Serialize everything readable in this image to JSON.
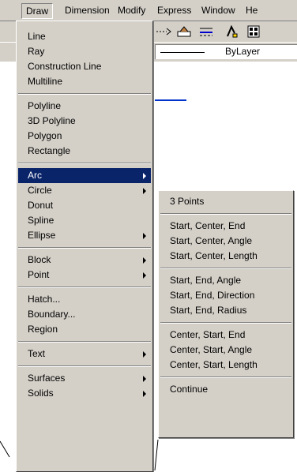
{
  "menubar": {
    "items": [
      "Draw",
      "Dimension",
      "Modify",
      "Express",
      "Window",
      "He"
    ]
  },
  "layer_combo": {
    "value": "ByLayer"
  },
  "draw_menu": {
    "groups": [
      [
        "Line",
        "Ray",
        "Construction Line",
        "Multiline"
      ],
      [
        "Polyline",
        "3D Polyline",
        "Polygon",
        "Rectangle"
      ],
      [
        "Arc",
        "Circle",
        "Donut",
        "Spline",
        "Ellipse"
      ],
      [
        "Block",
        "Point"
      ],
      [
        "Hatch...",
        "Boundary...",
        "Region"
      ],
      [
        "Text"
      ],
      [
        "Surfaces",
        "Solids"
      ]
    ],
    "submenu_items": [
      "Arc",
      "Circle",
      "Ellipse",
      "Block",
      "Point",
      "Text",
      "Surfaces",
      "Solids"
    ],
    "highlighted": "Arc"
  },
  "arc_menu": {
    "groups": [
      [
        "3 Points"
      ],
      [
        "Start, Center, End",
        "Start, Center, Angle",
        "Start, Center, Length"
      ],
      [
        "Start, End, Angle",
        "Start, End, Direction",
        "Start, End, Radius"
      ],
      [
        "Center, Start, End",
        "Center, Start, Angle",
        "Center, Start, Length"
      ],
      [
        "Continue"
      ]
    ]
  },
  "colors": {
    "menu_bg": "#d4d0c8",
    "highlight": "#0a246a"
  }
}
